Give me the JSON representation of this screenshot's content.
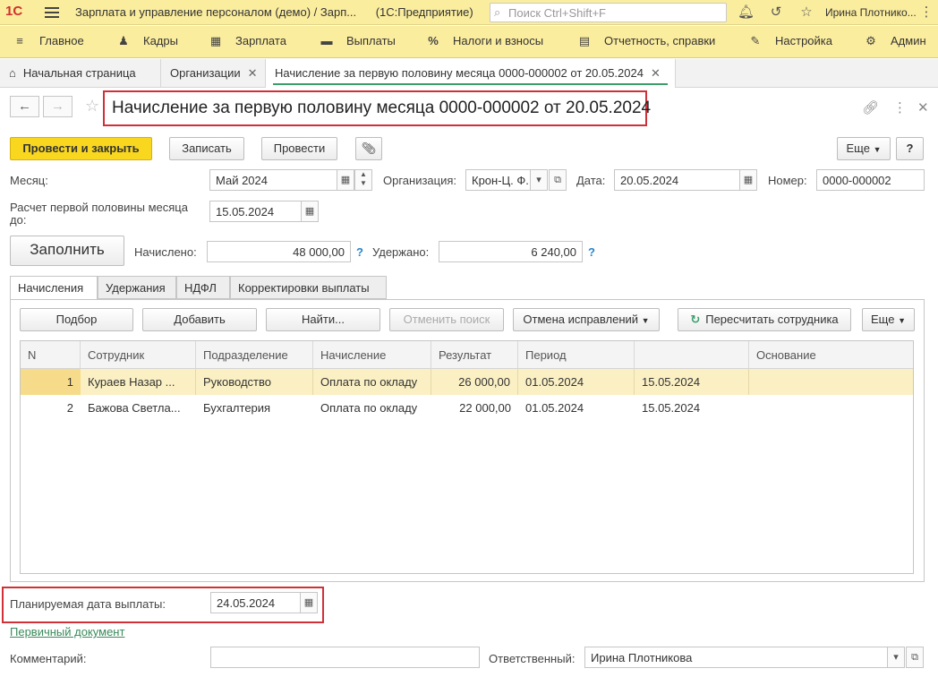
{
  "titlebar": {
    "logo": "1С",
    "app_title": "Зарплата и управление персоналом (демо) / Зарп...",
    "platform": "(1С:Предприятие)",
    "search_placeholder": "Поиск Ctrl+Shift+F",
    "user": "Ирина Плотнико..."
  },
  "sections": [
    {
      "icon": "≡",
      "label": "Главное"
    },
    {
      "icon": "♟",
      "label": "Кадры"
    },
    {
      "icon": "▦",
      "label": "Зарплата"
    },
    {
      "icon": "▬",
      "label": "Выплаты"
    },
    {
      "icon": "%",
      "label": "Налоги и взносы"
    },
    {
      "icon": "▤",
      "label": "Отчетность, справки"
    },
    {
      "icon": "✎",
      "label": "Настройка"
    },
    {
      "icon": "⚙",
      "label": "Админ"
    }
  ],
  "tabs": {
    "home": "Начальная страница",
    "orgs": "Организации",
    "doc": "Начисление за первую половину месяца 0000-000002 от 20.05.2024"
  },
  "doc": {
    "title": "Начисление за первую половину месяца 0000-000002 от 20.05.2024"
  },
  "toolbar": {
    "post_close": "Провести и закрыть",
    "save": "Записать",
    "post": "Провести",
    "more": "Еще",
    "help": "?"
  },
  "form": {
    "month_label": "Месяц:",
    "month_value": "Май 2024",
    "org_label": "Организация:",
    "org_value": "Крон-Ц. Ф.",
    "date_label": "Дата:",
    "date_value": "20.05.2024",
    "number_label": "Номер:",
    "number_value": "0000-000002",
    "calc_label_1": "Расчет первой половины месяца",
    "calc_label_2": "до:",
    "calc_value": "15.05.2024",
    "fill_button": "Заполнить",
    "accrued_label": "Начислено:",
    "accrued_value": "48 000,00",
    "withheld_label": "Удержано:",
    "withheld_value": "6 240,00",
    "q": "?"
  },
  "inner_tabs": [
    "Начисления",
    "Удержания",
    "НДФЛ",
    "Корректировки выплаты"
  ],
  "table_toolbar": {
    "select": "Подбор",
    "add": "Добавить",
    "find": "Найти...",
    "cancel_search": "Отменить поиск",
    "cancel_fixes": "Отмена исправлений",
    "recalc": "Пересчитать сотрудника",
    "more": "Еще"
  },
  "table": {
    "headers": [
      "N",
      "Сотрудник",
      "Подразделение",
      "Начисление",
      "Результат",
      "Период",
      "",
      "Основание"
    ],
    "rows": [
      [
        "1",
        "Кураев Назар ...",
        "Руководство",
        "Оплата по окладу",
        "26 000,00",
        "01.05.2024",
        "15.05.2024",
        ""
      ],
      [
        "2",
        "Бажова Светла...",
        "Бухгалтерия",
        "Оплата по окладу",
        "22 000,00",
        "01.05.2024",
        "15.05.2024",
        ""
      ]
    ]
  },
  "bottom": {
    "paydate_label": "Планируемая дата выплаты:",
    "paydate_value": "24.05.2024",
    "primary_doc": "Первичный документ",
    "comment_label": "Комментарий:",
    "comment_value": "",
    "responsible_label": "Ответственный:",
    "responsible_value": "Ирина Плотникова"
  },
  "colors": {
    "accent_yellow": "#fbed9e",
    "primary_button": "#f8d71e",
    "highlight_border": "#d03038",
    "selected_row": "#fbf0c4",
    "tab_underline": "#3b9d6b"
  }
}
